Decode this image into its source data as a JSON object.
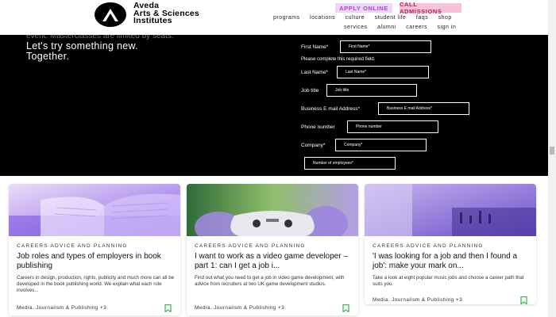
{
  "header": {
    "logo_line1": "Aveda",
    "logo_line2": "Arts & Sciences",
    "logo_line3": "Institutes",
    "apply_online": "APPLY ONLINE",
    "call_admissions": "CALL ADMISSIONS",
    "nav_primary": [
      "programs",
      "locations",
      "culture",
      "student life",
      "faqs",
      "shop"
    ],
    "nav_secondary": [
      "services",
      "alumni",
      "careers",
      "sign in"
    ]
  },
  "hero": {
    "cut_text": "event. Masterclasses are limited by seats.",
    "title_line1": "Let's try something new.",
    "title_line2": "Together."
  },
  "form": {
    "first_name_label": "First Name*",
    "first_name_placeholder": "First Name*",
    "error_message": "Please complete this required field.",
    "last_name_label": "Last Name*",
    "last_name_placeholder": "Last Name*",
    "job_title_label": "Job title",
    "job_title_placeholder": "Job title",
    "email_label": "Business E mail Address*",
    "email_placeholder": "Business E mail Address*",
    "phone_label": "Phone number",
    "phone_placeholder": "Phone number",
    "company_label": "Company*",
    "company_placeholder": "Company*",
    "employees_placeholder": "Number of employees*"
  },
  "cards": [
    {
      "category": "CAREERS ADVICE AND PLANNING",
      "title": "Job roles and types of employers in book publishing",
      "description": "Careers in design, production, rights, publicity and much more can all be developed in the book publishing world. We explain what each role involves...",
      "tags": "Media, Journalism & Publishing +3"
    },
    {
      "category": "CAREERS ADVICE AND PLANNING",
      "title": "I want to work as a video game developer – part 1: can I get a job i...",
      "description": "Find out what you need to get a job in video game development, with advice from recruiters at two UK game development studios.",
      "tags": "Media, Journalism & Publishing +3"
    },
    {
      "category": "CAREERS ADVICE AND PLANNING",
      "title": "'I was looking for a job and then I found a job': make your mark on...",
      "description": "Take a look at eight popular music jobs and choose a career path that suits you.",
      "tags": "Media, Journalism & Publishing +3"
    }
  ],
  "colors": {
    "apply_bg": "#e9d8f7",
    "apply_text": "#b63ccf",
    "call_bg": "#f6c2d8",
    "call_text": "#c2195c",
    "bookmark": "#3bb54a"
  }
}
